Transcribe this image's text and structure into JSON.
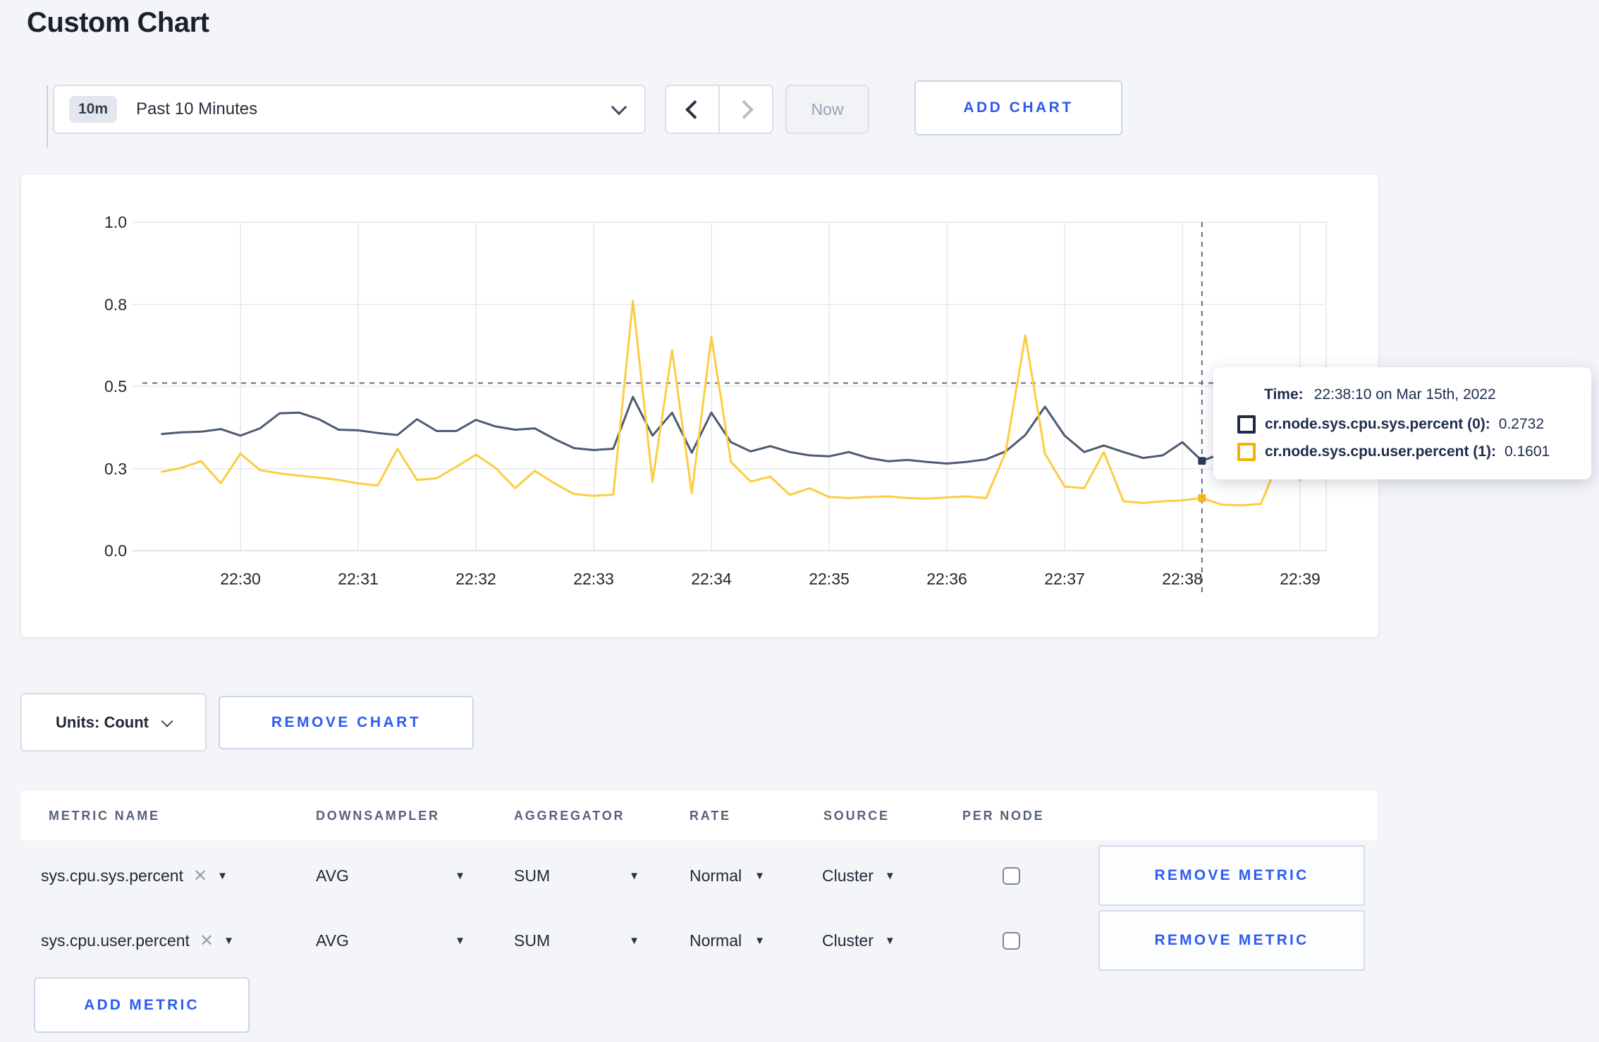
{
  "page": {
    "title": "Custom Chart"
  },
  "colors": {
    "accent_blue": "#2d5bf0",
    "page_bg": "#f4f5f9",
    "crosshair": "#5d6e8a"
  },
  "toolbar": {
    "time_range_badge": "10m",
    "time_range_label": "Past 10 Minutes",
    "now_label": "Now",
    "add_chart_label": "ADD CHART"
  },
  "chart_data": {
    "type": "line",
    "title": "",
    "xlabel": "",
    "ylabel": "",
    "ylim": [
      0,
      1
    ],
    "grid": true,
    "x_start": "22:29:20",
    "x_interval_seconds": 10,
    "x_ticks": [
      "22:30",
      "22:31",
      "22:32",
      "22:33",
      "22:34",
      "22:35",
      "22:36",
      "22:37",
      "22:38",
      "22:39"
    ],
    "y_ticks": [
      {
        "label": "0.0",
        "value": 0
      },
      {
        "label": "0.3",
        "value": 0.25
      },
      {
        "label": "0.5",
        "value": 0.5
      },
      {
        "label": "0.8",
        "value": 0.75
      },
      {
        "label": "1.0",
        "value": 1
      }
    ],
    "series": [
      {
        "name": "cr.node.sys.cpu.sys.percent",
        "color": "#4c5a74",
        "dot_color": "#2c3a55",
        "values": [
          0.355,
          0.36,
          0.362,
          0.37,
          0.35,
          0.372,
          0.418,
          0.42,
          0.4,
          0.368,
          0.366,
          0.358,
          0.352,
          0.4,
          0.364,
          0.364,
          0.398,
          0.378,
          0.368,
          0.372,
          0.34,
          0.312,
          0.306,
          0.31,
          0.468,
          0.35,
          0.42,
          0.298,
          0.42,
          0.33,
          0.302,
          0.318,
          0.3,
          0.29,
          0.287,
          0.3,
          0.282,
          0.272,
          0.276,
          0.27,
          0.265,
          0.27,
          0.278,
          0.302,
          0.352,
          0.438,
          0.35,
          0.3,
          0.32,
          0.3,
          0.282,
          0.29,
          0.33,
          0.2732,
          0.295,
          0.318,
          0.298,
          0.296,
          0.308,
          0.3
        ]
      },
      {
        "name": "cr.node.sys.cpu.user.percent",
        "color": "#fccd41",
        "dot_color": "#f5b31b",
        "values": [
          0.24,
          0.252,
          0.272,
          0.205,
          0.295,
          0.245,
          0.235,
          0.228,
          0.222,
          0.215,
          0.205,
          0.198,
          0.31,
          0.215,
          0.22,
          0.255,
          0.292,
          0.252,
          0.19,
          0.243,
          0.205,
          0.172,
          0.167,
          0.17,
          0.76,
          0.21,
          0.61,
          0.175,
          0.65,
          0.27,
          0.21,
          0.225,
          0.17,
          0.19,
          0.163,
          0.16,
          0.163,
          0.165,
          0.16,
          0.158,
          0.162,
          0.165,
          0.16,
          0.3,
          0.655,
          0.295,
          0.195,
          0.19,
          0.3,
          0.15,
          0.145,
          0.15,
          0.153,
          0.1601,
          0.14,
          0.138,
          0.142,
          0.285,
          0.215,
          0.27
        ]
      }
    ],
    "crosshair": {
      "x_time": "22:38:10",
      "x_index": 53,
      "h_line_value": 0.51,
      "point_values": [
        0.2732,
        0.1601
      ]
    },
    "legend_position": "tooltip"
  },
  "tooltip": {
    "time_label": "Time:",
    "time_value": "22:38:10 on Mar 15th, 2022",
    "entries": [
      {
        "label": "cr.node.sys.cpu.sys.percent (0):",
        "value": "0.2732",
        "color": "#1f2a44"
      },
      {
        "label": "cr.node.sys.cpu.user.percent (1):",
        "value": "0.1601",
        "color": "#f2b204"
      }
    ]
  },
  "chart_controls": {
    "units_label": "Units: Count",
    "remove_chart_label": "REMOVE CHART"
  },
  "metrics_table": {
    "headers": [
      "METRIC NAME",
      "DOWNSAMPLER",
      "AGGREGATOR",
      "RATE",
      "SOURCE",
      "PER NODE"
    ],
    "rows": [
      {
        "metric": "sys.cpu.sys.percent",
        "downsampler": "AVG",
        "aggregator": "SUM",
        "rate": "Normal",
        "source": "Cluster",
        "per_node_checked": false,
        "remove_label": "REMOVE METRIC"
      },
      {
        "metric": "sys.cpu.user.percent",
        "downsampler": "AVG",
        "aggregator": "SUM",
        "rate": "Normal",
        "source": "Cluster",
        "per_node_checked": false,
        "remove_label": "REMOVE METRIC"
      }
    ],
    "add_metric_label": "ADD METRIC"
  }
}
